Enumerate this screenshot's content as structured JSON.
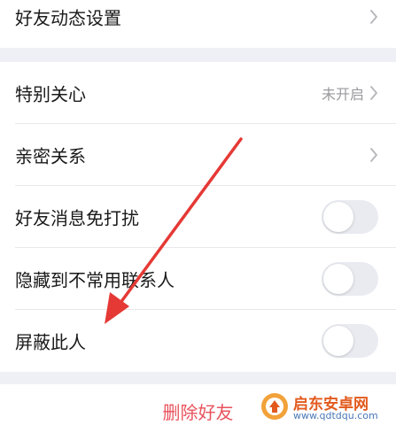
{
  "settings": {
    "friend_feed": {
      "label": "好友动态设置"
    },
    "special_care": {
      "label": "特别关心",
      "value": "未开启"
    },
    "intimacy": {
      "label": "亲密关系"
    },
    "mute_messages": {
      "label": "好友消息免打扰",
      "enabled": false
    },
    "hide_contact": {
      "label": "隐藏到不常用联系人",
      "enabled": false
    },
    "block_person": {
      "label": "屏蔽此人",
      "enabled": false
    }
  },
  "footer": {
    "delete_label": "删除好友"
  },
  "watermark": {
    "title": "启东安卓网",
    "url": "www.qdtdqu.com"
  },
  "colors": {
    "background": "#eef0f5",
    "delete_text": "#e8525c",
    "annotation_arrow": "#e53935",
    "toggle_off": "#e9ebf1"
  },
  "icons": {
    "chevron": "chevron-right-icon",
    "annotation": "red-arrow-annotation"
  }
}
